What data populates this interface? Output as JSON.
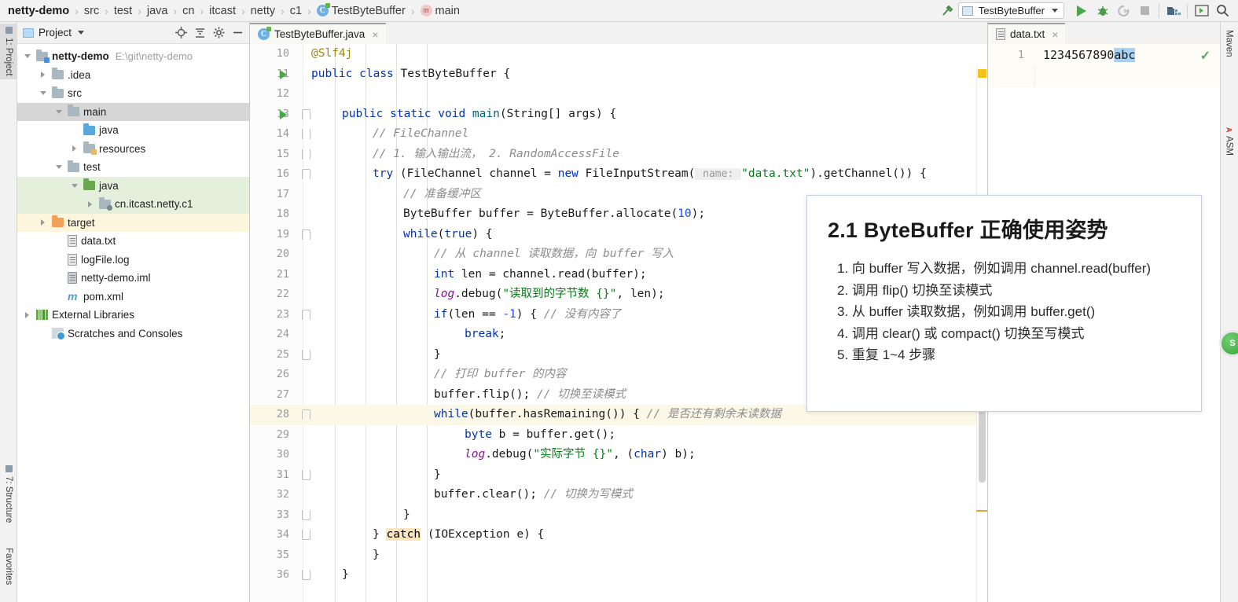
{
  "topbar": {
    "breadcrumbs": [
      {
        "label": "netty-demo",
        "icon": "none",
        "root": true
      },
      {
        "label": "src",
        "icon": "none"
      },
      {
        "label": "test",
        "icon": "none"
      },
      {
        "label": "java",
        "icon": "none"
      },
      {
        "label": "cn",
        "icon": "none"
      },
      {
        "label": "itcast",
        "icon": "none"
      },
      {
        "label": "netty",
        "icon": "none"
      },
      {
        "label": "c1",
        "icon": "none"
      },
      {
        "label": "TestByteBuffer",
        "icon": "class-icon"
      },
      {
        "label": "main",
        "icon": "method-icon"
      }
    ],
    "separator": "›",
    "build_icon": "hammer-icon",
    "run_config": "TestByteBuffer",
    "buttons": [
      {
        "name": "run-button",
        "icon": "play-icon"
      },
      {
        "name": "debug-button",
        "icon": "bug-icon"
      },
      {
        "name": "run-with-coverage-button",
        "icon": "coverage-icon"
      },
      {
        "name": "stop-button",
        "icon": "stop-icon"
      },
      {
        "name": "project-structure-button",
        "icon": "project-structure-icon"
      },
      {
        "name": "terminal-button",
        "icon": "terminal-icon"
      },
      {
        "name": "search-everywhere-button",
        "icon": "search-icon"
      }
    ]
  },
  "left_strip": {
    "tabs": [
      {
        "label": "1: Project",
        "active": true
      },
      {
        "label": "7: Structure",
        "active": false
      },
      {
        "label": "Favorites",
        "active": false
      }
    ]
  },
  "right_strip": {
    "tabs": [
      {
        "label": "Maven",
        "active": false
      },
      {
        "label": "ASM",
        "active": false
      }
    ],
    "floating_badge": "S"
  },
  "project_panel": {
    "title": "Project",
    "header_icons": [
      "target-icon",
      "collapse-all-icon",
      "gear-icon",
      "minimize-icon"
    ],
    "tree": [
      {
        "label": "netty-demo",
        "path": "E:\\git\\netty-demo",
        "indent": 0,
        "arrow": "down",
        "icon": "module-folder",
        "bold": true,
        "hl": "none"
      },
      {
        "label": ".idea",
        "path": "",
        "indent": 1,
        "arrow": "right",
        "icon": "folder-gray",
        "bold": false,
        "hl": "none"
      },
      {
        "label": "src",
        "path": "",
        "indent": 1,
        "arrow": "down",
        "icon": "folder-gray",
        "bold": false,
        "hl": "none"
      },
      {
        "label": "main",
        "path": "",
        "indent": 2,
        "arrow": "down",
        "icon": "folder-gray",
        "bold": false,
        "hl": "gray"
      },
      {
        "label": "java",
        "path": "",
        "indent": 3,
        "arrow": "none",
        "icon": "folder-blue",
        "bold": false,
        "hl": "none"
      },
      {
        "label": "resources",
        "path": "",
        "indent": 3,
        "arrow": "right",
        "icon": "folder-resources",
        "bold": false,
        "hl": "none"
      },
      {
        "label": "test",
        "path": "",
        "indent": 2,
        "arrow": "down",
        "icon": "folder-gray",
        "bold": false,
        "hl": "none"
      },
      {
        "label": "java",
        "path": "",
        "indent": 3,
        "arrow": "down",
        "icon": "folder-green",
        "bold": false,
        "hl": "green"
      },
      {
        "label": "cn.itcast.netty.c1",
        "path": "",
        "indent": 4,
        "arrow": "right",
        "icon": "package-icon",
        "bold": false,
        "hl": "green"
      },
      {
        "label": "target",
        "path": "",
        "indent": 1,
        "arrow": "right",
        "icon": "folder-orange",
        "bold": false,
        "hl": "yellow"
      },
      {
        "label": "data.txt",
        "path": "",
        "indent": 2,
        "arrow": "none",
        "icon": "file-text",
        "bold": false,
        "hl": "none"
      },
      {
        "label": "logFile.log",
        "path": "",
        "indent": 2,
        "arrow": "none",
        "icon": "file-text",
        "bold": false,
        "hl": "none"
      },
      {
        "label": "netty-demo.iml",
        "path": "",
        "indent": 2,
        "arrow": "none",
        "icon": "file-iml",
        "bold": false,
        "hl": "none"
      },
      {
        "label": "pom.xml",
        "path": "",
        "indent": 2,
        "arrow": "none",
        "icon": "maven-icon",
        "bold": false,
        "hl": "none"
      },
      {
        "label": "External Libraries",
        "path": "",
        "indent": 0,
        "arrow": "right",
        "icon": "libraries-icon",
        "bold": false,
        "hl": "none"
      },
      {
        "label": "Scratches and Consoles",
        "path": "",
        "indent": 1,
        "arrow": "none",
        "icon": "scratches-icon",
        "bold": false,
        "hl": "none"
      }
    ]
  },
  "editor": {
    "tab": {
      "label": "TestByteBuffer.java",
      "icon": "java-class-icon",
      "close": "×"
    },
    "lines": [
      {
        "num": "10",
        "indent": 1,
        "run": false,
        "fold": "none",
        "hl": false,
        "tokens": [
          {
            "t": "@Slf4j",
            "c": "ann"
          }
        ]
      },
      {
        "num": "11",
        "indent": 1,
        "run": true,
        "fold": "none",
        "hl": false,
        "tokens": [
          {
            "t": "public",
            "c": "kw"
          },
          {
            "t": " ",
            "c": "ident"
          },
          {
            "t": "class",
            "c": "kw"
          },
          {
            "t": " TestByteBuffer {",
            "c": "cls"
          }
        ]
      },
      {
        "num": "12",
        "indent": 1,
        "run": false,
        "fold": "none",
        "hl": false,
        "tokens": []
      },
      {
        "num": "13",
        "indent": 2,
        "run": true,
        "fold": "start",
        "hl": false,
        "tokens": [
          {
            "t": "public",
            "c": "kw"
          },
          {
            "t": " ",
            "c": "ident"
          },
          {
            "t": "static",
            "c": "kw"
          },
          {
            "t": " ",
            "c": "ident"
          },
          {
            "t": "void",
            "c": "kw"
          },
          {
            "t": " ",
            "c": "ident"
          },
          {
            "t": "main",
            "c": "mth"
          },
          {
            "t": "(String[] args) {",
            "c": "ident"
          }
        ]
      },
      {
        "num": "14",
        "indent": 3,
        "run": false,
        "fold": "mid",
        "hl": false,
        "tokens": [
          {
            "t": "// FileChannel",
            "c": "cmt"
          }
        ]
      },
      {
        "num": "15",
        "indent": 3,
        "run": false,
        "fold": "mid",
        "hl": false,
        "tokens": [
          {
            "t": "// 1. 输入输出流， 2. RandomAccessFile",
            "c": "cmt"
          }
        ]
      },
      {
        "num": "16",
        "indent": 3,
        "run": false,
        "fold": "start",
        "hl": false,
        "tokens": [
          {
            "t": "try",
            "c": "kw"
          },
          {
            "t": " (FileChannel channel = ",
            "c": "ident"
          },
          {
            "t": "new",
            "c": "kw"
          },
          {
            "t": " FileInputStream(",
            "c": "ident"
          },
          {
            "t": " name: ",
            "c": "hint"
          },
          {
            "t": "\"data.txt\"",
            "c": "str"
          },
          {
            "t": ").getChannel()) {",
            "c": "ident"
          }
        ]
      },
      {
        "num": "17",
        "indent": 4,
        "run": false,
        "fold": "none",
        "hl": false,
        "tokens": [
          {
            "t": "// 准备缓冲区",
            "c": "cmt"
          }
        ]
      },
      {
        "num": "18",
        "indent": 4,
        "run": false,
        "fold": "none",
        "hl": false,
        "tokens": [
          {
            "t": "ByteBuffer buffer = ByteBuffer.allocate(",
            "c": "ident"
          },
          {
            "t": "10",
            "c": "num"
          },
          {
            "t": ");",
            "c": "ident"
          }
        ]
      },
      {
        "num": "19",
        "indent": 4,
        "run": false,
        "fold": "start",
        "hl": false,
        "tokens": [
          {
            "t": "while",
            "c": "kw"
          },
          {
            "t": "(",
            "c": "ident"
          },
          {
            "t": "true",
            "c": "kw"
          },
          {
            "t": ") {",
            "c": "ident"
          }
        ]
      },
      {
        "num": "20",
        "indent": 5,
        "run": false,
        "fold": "none",
        "hl": false,
        "tokens": [
          {
            "t": "// 从 channel 读取数据，向 buffer 写入",
            "c": "cmt"
          }
        ]
      },
      {
        "num": "21",
        "indent": 5,
        "run": false,
        "fold": "none",
        "hl": false,
        "tokens": [
          {
            "t": "int",
            "c": "kw"
          },
          {
            "t": " len = channel.read(buffer);",
            "c": "ident"
          }
        ]
      },
      {
        "num": "22",
        "indent": 5,
        "run": false,
        "fold": "none",
        "hl": false,
        "tokens": [
          {
            "t": "log",
            "c": "fld"
          },
          {
            "t": ".debug(",
            "c": "ident"
          },
          {
            "t": "\"读取到的字节数 {}\"",
            "c": "str"
          },
          {
            "t": ", len);",
            "c": "ident"
          }
        ]
      },
      {
        "num": "23",
        "indent": 5,
        "run": false,
        "fold": "start",
        "hl": false,
        "tokens": [
          {
            "t": "if",
            "c": "kw"
          },
          {
            "t": "(len == ",
            "c": "ident"
          },
          {
            "t": "-1",
            "c": "num"
          },
          {
            "t": ") { ",
            "c": "ident"
          },
          {
            "t": "// 没有内容了",
            "c": "cmt"
          }
        ]
      },
      {
        "num": "24",
        "indent": 6,
        "run": false,
        "fold": "none",
        "hl": false,
        "tokens": [
          {
            "t": "break",
            "c": "kw"
          },
          {
            "t": ";",
            "c": "ident"
          }
        ]
      },
      {
        "num": "25",
        "indent": 5,
        "run": false,
        "fold": "end",
        "hl": false,
        "tokens": [
          {
            "t": "}",
            "c": "ident"
          }
        ]
      },
      {
        "num": "26",
        "indent": 5,
        "run": false,
        "fold": "none",
        "hl": false,
        "tokens": [
          {
            "t": "// 打印 buffer 的内容",
            "c": "cmt"
          }
        ]
      },
      {
        "num": "27",
        "indent": 5,
        "run": false,
        "fold": "none",
        "hl": false,
        "tokens": [
          {
            "t": "buffer.flip(); ",
            "c": "ident"
          },
          {
            "t": "// 切换至读模式",
            "c": "cmt"
          }
        ]
      },
      {
        "num": "28",
        "indent": 5,
        "run": false,
        "fold": "start",
        "hl": true,
        "tokens": [
          {
            "t": "while",
            "c": "kw"
          },
          {
            "t": "(buffer.hasRemaining()) { ",
            "c": "ident"
          },
          {
            "t": "// 是否还有剩余未读数据",
            "c": "cmt"
          }
        ]
      },
      {
        "num": "29",
        "indent": 6,
        "run": false,
        "fold": "none",
        "hl": false,
        "tokens": [
          {
            "t": "byte",
            "c": "kw"
          },
          {
            "t": " b = buffer.get();",
            "c": "ident"
          }
        ]
      },
      {
        "num": "30",
        "indent": 6,
        "run": false,
        "fold": "none",
        "hl": false,
        "tokens": [
          {
            "t": "log",
            "c": "fld"
          },
          {
            "t": ".debug(",
            "c": "ident"
          },
          {
            "t": "\"实际字节 {}\"",
            "c": "str"
          },
          {
            "t": ", (",
            "c": "ident"
          },
          {
            "t": "char",
            "c": "kw"
          },
          {
            "t": ") b);",
            "c": "ident"
          }
        ]
      },
      {
        "num": "31",
        "indent": 5,
        "run": false,
        "fold": "end",
        "hl": false,
        "tokens": [
          {
            "t": "}",
            "c": "ident"
          }
        ]
      },
      {
        "num": "32",
        "indent": 5,
        "run": false,
        "fold": "none",
        "hl": false,
        "tokens": [
          {
            "t": "buffer.clear(); ",
            "c": "ident"
          },
          {
            "t": "// 切换为写模式",
            "c": "cmt"
          }
        ]
      },
      {
        "num": "33",
        "indent": 4,
        "run": false,
        "fold": "end",
        "hl": false,
        "tokens": [
          {
            "t": "}",
            "c": "ident"
          }
        ]
      },
      {
        "num": "34",
        "indent": 3,
        "run": false,
        "fold": "end",
        "hl": false,
        "tokens": [
          {
            "t": "} ",
            "c": "ident"
          },
          {
            "t": "catch",
            "c": "mark-catch"
          },
          {
            "t": " (IOException e) {",
            "c": "ident"
          }
        ]
      },
      {
        "num": "35",
        "indent": 3,
        "run": false,
        "fold": "none",
        "hl": false,
        "tokens": [
          {
            "t": "}",
            "c": "ident"
          }
        ]
      },
      {
        "num": "36",
        "indent": 2,
        "run": false,
        "fold": "end",
        "hl": false,
        "tokens": [
          {
            "t": "}",
            "c": "ident"
          }
        ]
      }
    ]
  },
  "data_panel": {
    "tab": {
      "label": "data.txt",
      "icon": "file-text-icon",
      "close": "×"
    },
    "line_number": "1",
    "content_plain": "1234567890",
    "content_selected": "abc",
    "status_icon": "check-icon"
  },
  "overlay": {
    "title": "2.1  ByteBuffer 正确使用姿势",
    "items": [
      "1. 向 buffer 写入数据，例如调用 channel.read(buffer)",
      "2. 调用 flip() 切换至读模式",
      "3. 从 buffer 读取数据，例如调用 buffer.get()",
      "4. 调用 clear() 或 compact() 切换至写模式",
      "5. 重复 1~4 步骤"
    ]
  },
  "colors": {
    "accent_green": "#4ca64c",
    "keyword_blue": "#0033b3",
    "string_green": "#067d17",
    "comment_gray": "#8c8c8c",
    "selection_blue": "#a6d2f5",
    "highlight_yellow": "#fcf8e8"
  }
}
